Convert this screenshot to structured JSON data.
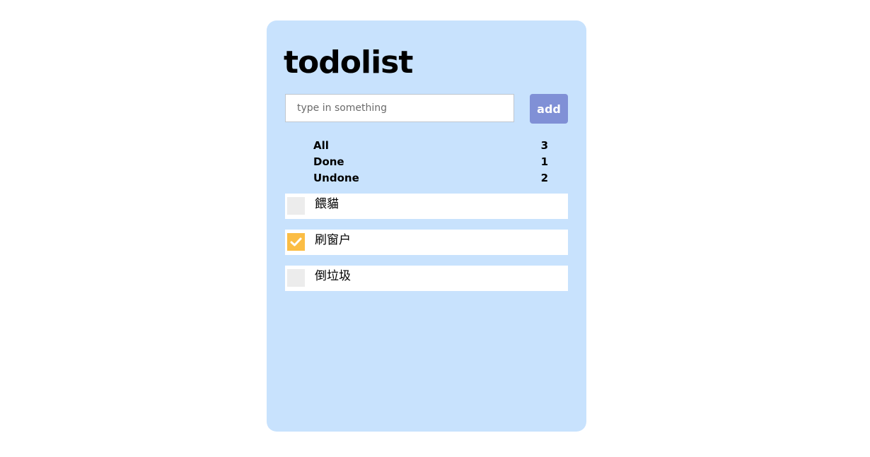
{
  "app": {
    "title": "todolist"
  },
  "input": {
    "placeholder": "type in something",
    "value": "",
    "add_label": "add"
  },
  "stats": [
    {
      "label": "All",
      "count": "3"
    },
    {
      "label": "Done",
      "count": "1"
    },
    {
      "label": "Undone",
      "count": "2"
    }
  ],
  "todos": [
    {
      "text": "餵貓",
      "done": false
    },
    {
      "text": "刷窗户",
      "done": true
    },
    {
      "text": "倒垃圾",
      "done": false
    }
  ],
  "colors": {
    "card_background": "#c8e2fd",
    "add_button": "#8090d6",
    "checkbox_checked": "#fbbd45",
    "checkbox_unchecked": "#ececec"
  },
  "icons": {
    "checkmark": "check-icon"
  }
}
